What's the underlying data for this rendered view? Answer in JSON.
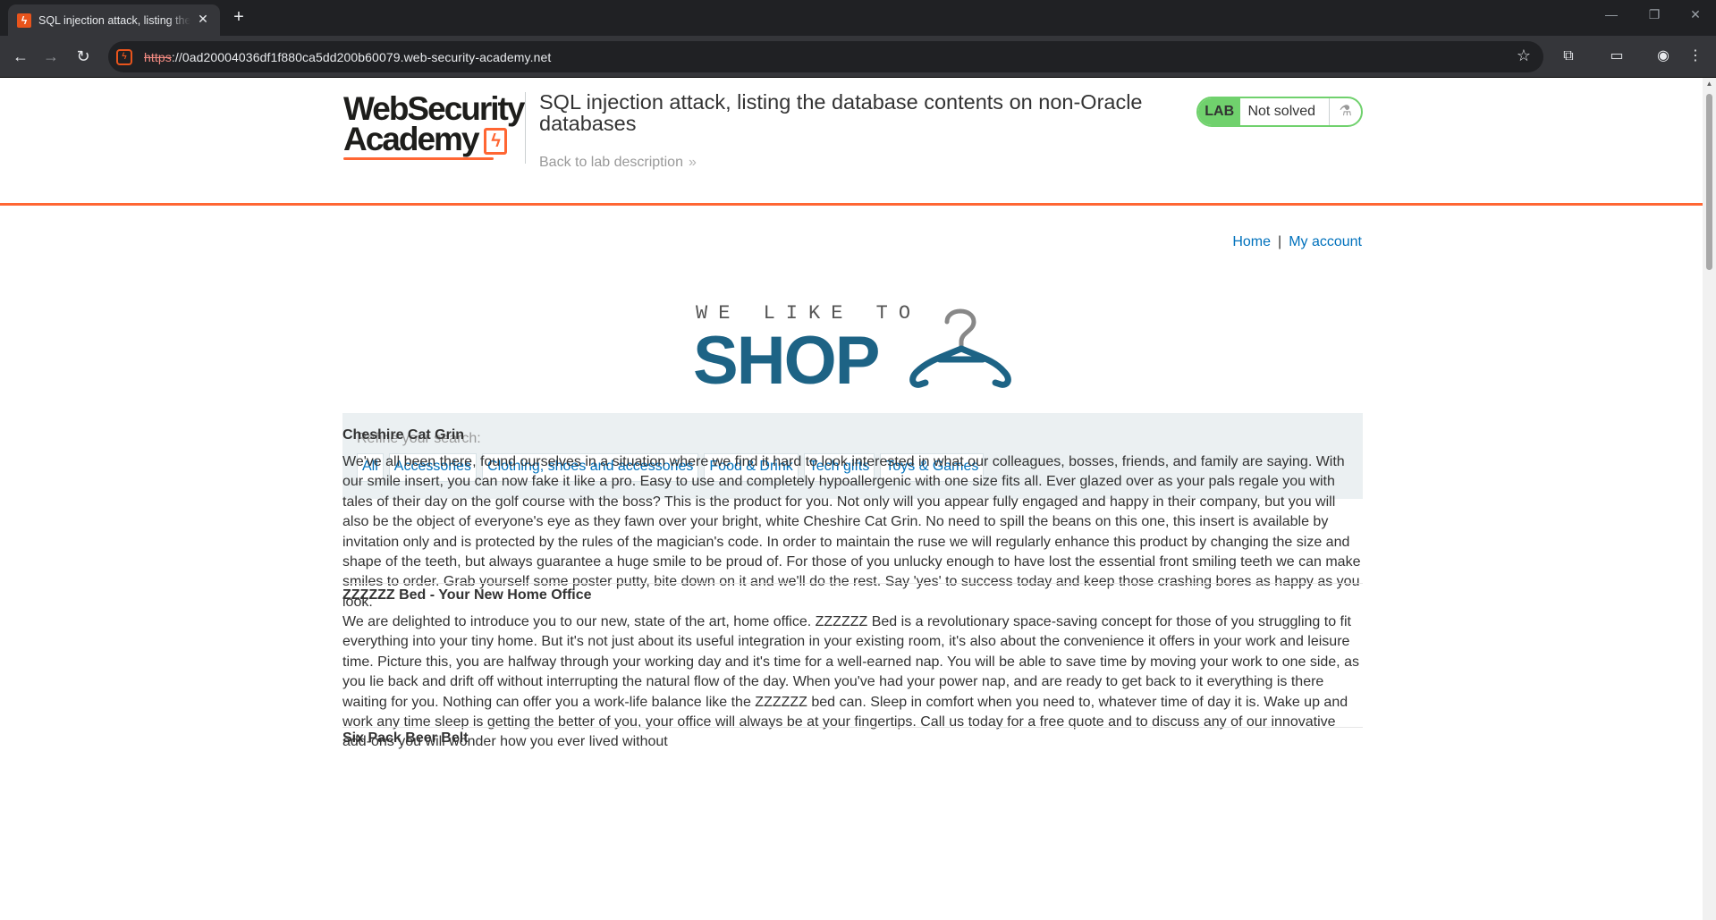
{
  "browser": {
    "tab_title": "SQL injection attack, listing the database contents on non-Oracle databases",
    "url_scheme": "https",
    "url_rest": "://0ad20004036df1f880ca5dd200b60079.web-security-academy.net",
    "new_tab": "+",
    "close_tab": "✕"
  },
  "academy": {
    "logo_line1": "WebSecurity",
    "logo_line2": "Academy",
    "lab_title": "SQL injection attack, listing the database contents on non-Oracle databases",
    "back_link": "Back to lab description",
    "lab_badge": "LAB",
    "lab_state": "Not solved"
  },
  "nav": {
    "home": "Home",
    "separator": "|",
    "my_account": "My account"
  },
  "shop_logo": {
    "tagline": "WE LIKE TO",
    "word": "SHOP"
  },
  "refine": {
    "label": "Refine your search:",
    "filters": [
      "All",
      "Accessories",
      "Clothing, shoes and accessories",
      "Food & Drink",
      "Tech gifts",
      "Toys & Games"
    ]
  },
  "products": [
    {
      "name": "Cheshire Cat Grin",
      "description": "We've all been there, found ourselves in a situation where we find it hard to look interested in what our colleagues, bosses, friends, and family are saying. With our smile insert, you can now fake it like a pro. Easy to use and completely hypoallergenic with one size fits all. Ever glazed over as your pals regale you with tales of their day on the golf course with the boss? This is the product for you. Not only will you appear fully engaged and happy in their company, but you will also be the object of everyone's eye as they fawn over your bright, white Cheshire Cat Grin. No need to spill the beans on this one, this insert is available by invitation only and is protected by the rules of the magician's code. In order to maintain the ruse we will regularly enhance this product by changing the size and shape of the teeth, but always guarantee a huge smile to be proud of. For those of you unlucky enough to have lost the essential front smiling teeth we can make smiles to order. Grab yourself some poster putty, bite down on it and we'll do the rest. Say 'yes' to success today and keep those crashing bores as happy as you look."
    },
    {
      "name": "ZZZZZZ Bed - Your New Home Office",
      "description": "We are delighted to introduce you to our new, state of the art, home office. ZZZZZZ Bed is a revolutionary space-saving concept for those of you struggling to fit everything into your tiny home. But it's not just about its useful integration in your existing room, it's also about the convenience it offers in your work and leisure time. Picture this, you are halfway through your working day and it's time for a well-earned nap. You will be able to save time by moving your work to one side, as you lie back and drift off without interrupting the natural flow of the day. When you've had your power nap, and are ready to get back to it everything is there waiting for you. Nothing can offer you a work-life balance like the ZZZZZZ bed can. Sleep in comfort when you need to, whatever time of day it is. Wake up and work any time sleep is getting the better of you, your office will always be at your fingertips. Call us today for a free quote and to discuss any of our innovative add-ons you will wonder how you ever lived without"
    },
    {
      "name": "Six Pack Beer Belt",
      "description": ""
    }
  ]
}
